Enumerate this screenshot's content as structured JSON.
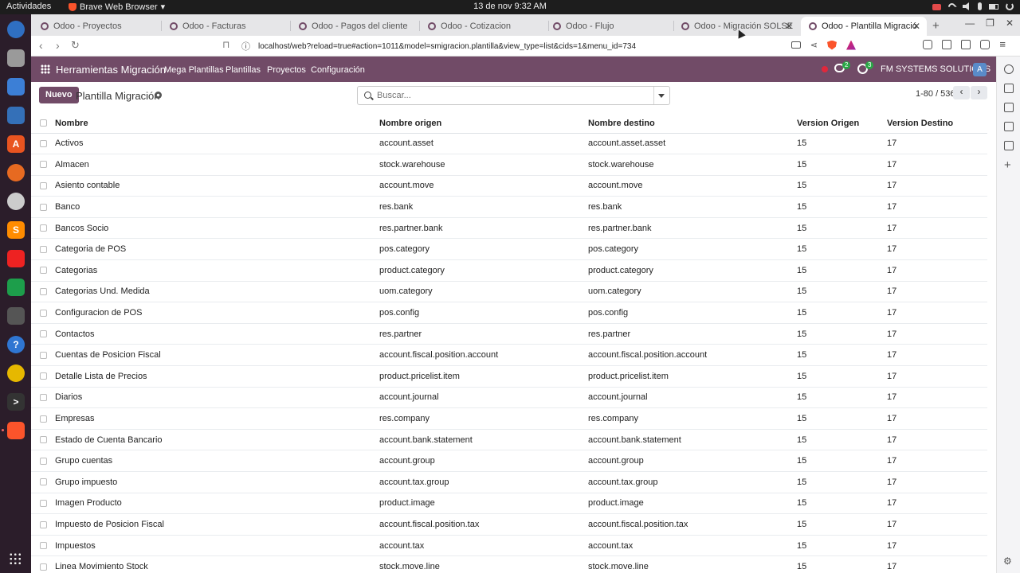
{
  "os": {
    "activities": "Actividades",
    "app_name": "Brave Web Browser",
    "clock": "13 de nov  9:32 AM"
  },
  "browser": {
    "tabs": [
      {
        "title": "Odoo - Proyectos"
      },
      {
        "title": "Odoo - Facturas"
      },
      {
        "title": "Odoo - Pagos del cliente"
      },
      {
        "title": "Odoo - Cotizacion"
      },
      {
        "title": "Odoo - Flujo"
      },
      {
        "title": "Odoo - Migración SOLSE"
      },
      {
        "title": "Odoo - Plantilla Migració"
      }
    ],
    "url": "localhost/web?reload=true#action=1011&model=smigracion.plantilla&view_type=list&cids=1&menu_id=734"
  },
  "odoo": {
    "app_title": "Herramientas Migración",
    "menu": [
      "Mega Plantillas",
      "Plantillas",
      "Proyectos",
      "Configuración"
    ],
    "messages_badge": "2",
    "activities_badge": "3",
    "company": "FM SYSTEMS SOLUTIONS",
    "avatar": "A",
    "new_button": "Nuevo",
    "breadcrumb": "Plantilla Migración",
    "search_placeholder": "Buscar...",
    "pager": "1-80 / 536",
    "columns": [
      "Nombre",
      "Nombre origen",
      "Nombre destino",
      "Version Origen",
      "Version Destino"
    ],
    "rows": [
      [
        "Activos",
        "account.asset",
        "account.asset.asset",
        "15",
        "17"
      ],
      [
        "Almacen",
        "stock.warehouse",
        "stock.warehouse",
        "15",
        "17"
      ],
      [
        "Asiento contable",
        "account.move",
        "account.move",
        "15",
        "17"
      ],
      [
        "Banco",
        "res.bank",
        "res.bank",
        "15",
        "17"
      ],
      [
        "Bancos Socio",
        "res.partner.bank",
        "res.partner.bank",
        "15",
        "17"
      ],
      [
        "Categoria de POS",
        "pos.category",
        "pos.category",
        "15",
        "17"
      ],
      [
        "Categorias",
        "product.category",
        "product.category",
        "15",
        "17"
      ],
      [
        "Categorias Und. Medida",
        "uom.category",
        "uom.category",
        "15",
        "17"
      ],
      [
        "Configuracion de POS",
        "pos.config",
        "pos.config",
        "15",
        "17"
      ],
      [
        "Contactos",
        "res.partner",
        "res.partner",
        "15",
        "17"
      ],
      [
        "Cuentas de Posicion Fiscal",
        "account.fiscal.position.account",
        "account.fiscal.position.account",
        "15",
        "17"
      ],
      [
        "Detalle Lista de Precios",
        "product.pricelist.item",
        "product.pricelist.item",
        "15",
        "17"
      ],
      [
        "Diarios",
        "account.journal",
        "account.journal",
        "15",
        "17"
      ],
      [
        "Empresas",
        "res.company",
        "res.company",
        "15",
        "17"
      ],
      [
        "Estado de Cuenta Bancario",
        "account.bank.statement",
        "account.bank.statement",
        "15",
        "17"
      ],
      [
        "Grupo cuentas",
        "account.group",
        "account.group",
        "15",
        "17"
      ],
      [
        "Grupo impuesto",
        "account.tax.group",
        "account.tax.group",
        "15",
        "17"
      ],
      [
        "Imagen Producto",
        "product.image",
        "product.image",
        "15",
        "17"
      ],
      [
        "Impuesto de Posicion Fiscal",
        "account.fiscal.position.tax",
        "account.fiscal.position.tax",
        "15",
        "17"
      ],
      [
        "Impuestos",
        "account.tax",
        "account.tax",
        "15",
        "17"
      ],
      [
        "Linea Movimiento Stock",
        "stock.move.line",
        "stock.move.line",
        "15",
        "17"
      ]
    ]
  },
  "colors": {
    "odoo_primary": "#714b67",
    "brave_orange": "#fb542b"
  }
}
